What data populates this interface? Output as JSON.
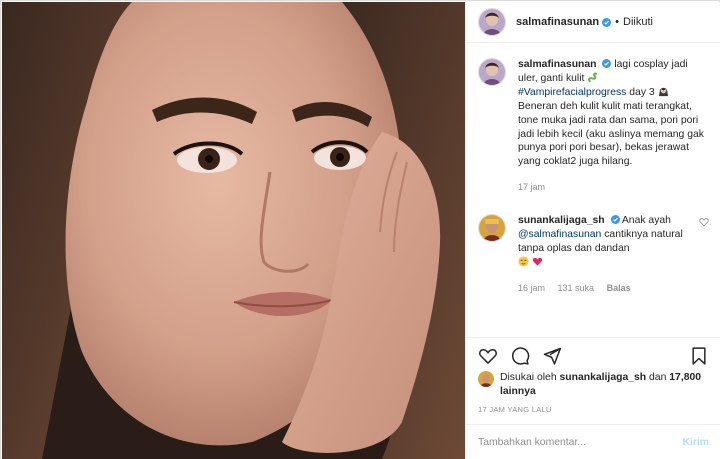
{
  "post": {
    "author": "salmafinasunan",
    "follow_status": "Diikuti",
    "dot": "•"
  },
  "caption": {
    "username": "salmafinasunan",
    "text_1": "lagi cosplay jadi uler, ganti kulit",
    "hashtag": "#Vampirefacialprogress",
    "text_2": "day 3",
    "text_3": "Beneran deh kulit kulit mati terangkat, tone muka jadi rata dan sama, pori pori jadi lebih kecil (aku aslinya memang gak punya pori pori besar), bekas jerawat yang coklat2 juga hilang.",
    "age": "17 jam"
  },
  "comment": {
    "username": "sunankalijaga_sh",
    "text_1": "Anak ayah",
    "mention": "@salmafinasunan",
    "text_2": "cantiknya natural tanpa oplas dan dandan",
    "age": "16 jam",
    "likes": "131 suka",
    "reply": "Balas"
  },
  "likes": {
    "prefix": "Disukai oleh",
    "user": "sunankalijaga_sh",
    "mid": "dan",
    "others": "17,800 lainnya"
  },
  "timestamp": "17 JAM YANG LALU",
  "composer": {
    "placeholder": "Tambahkan komentar...",
    "send": "Kirim"
  },
  "colors": {
    "link": "#00376b",
    "verified": "#3897f0",
    "muted": "#8e8e8e",
    "send_disabled": "#b2dffc",
    "heart": "#ed4956"
  }
}
